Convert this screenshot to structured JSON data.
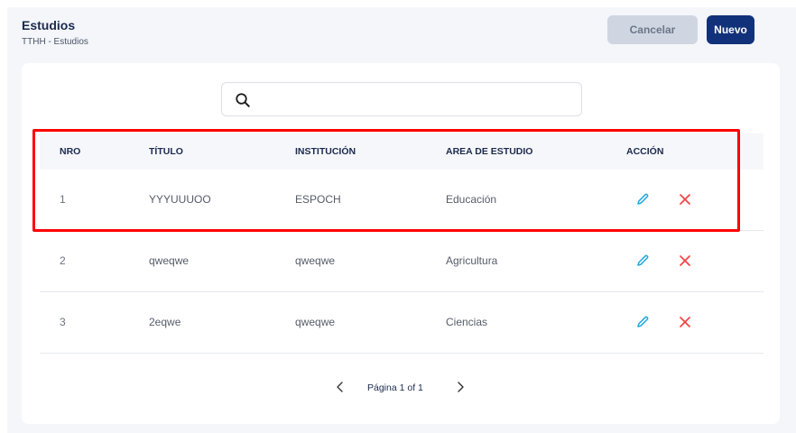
{
  "header": {
    "title": "Estudios",
    "breadcrumb": "TTHH  - Estudios",
    "cancel_label": "Cancelar",
    "new_label": "Nuevo"
  },
  "search": {
    "icon": "search-icon",
    "value": "",
    "placeholder": ""
  },
  "table": {
    "columns": [
      "NRO",
      "TÍTULO",
      "INSTITUCIÓN",
      "AREA DE ESTUDIO",
      "ACCIÓN"
    ],
    "rows": [
      {
        "nro": "1",
        "titulo": "YYYUUUOO",
        "institucion": "ESPOCH",
        "area": "Educación"
      },
      {
        "nro": "2",
        "titulo": "qweqwe",
        "institucion": "qweqwe",
        "area": "Agricultura"
      },
      {
        "nro": "3",
        "titulo": "2eqwe",
        "institucion": "qweqwe",
        "area": "Ciencias"
      }
    ],
    "action_icons": [
      "edit-icon",
      "delete-icon"
    ]
  },
  "pagination": {
    "label": "Página 1 of 1"
  },
  "colors": {
    "primary": "#11327a",
    "edit": "#1ea7e0",
    "delete": "#ef4444",
    "highlight": "#ff0000"
  }
}
